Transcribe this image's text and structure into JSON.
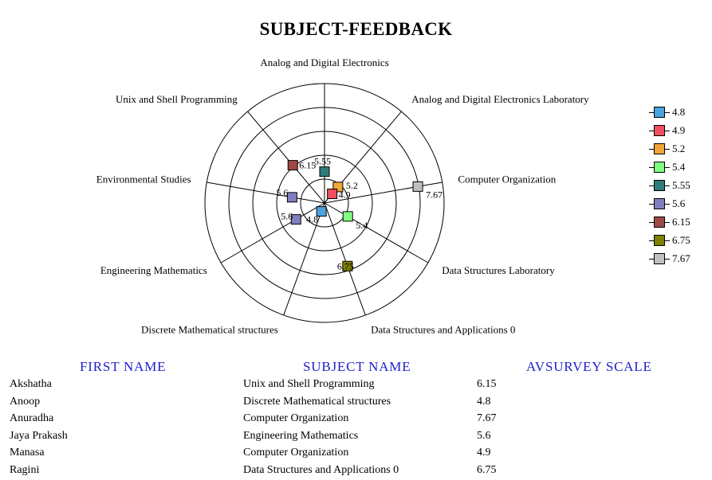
{
  "title": "SUBJECT-FEEDBACK",
  "chart_data": {
    "type": "radar",
    "categories": [
      "Analog and Digital Electronics",
      "Analog and Digital Electronics Laboratory",
      "Computer Organization",
      "Data Structures Laboratory",
      "Data Structures and Applications 0",
      "Discrete Mathematical structures",
      "Engineering Mathematics",
      "Environmental Studies",
      "Unix and Shell Programming"
    ],
    "rlim": [
      4.5,
      8.5
    ],
    "grid": true,
    "legend_position": "right",
    "points": [
      {
        "axis": 0,
        "value": 5.55,
        "label": "5.55",
        "color": "#2e7b7b"
      },
      {
        "axis": 1,
        "value": 5.2,
        "label": "5.2",
        "color": "#f2a536"
      },
      {
        "axis": 1,
        "value": 4.9,
        "label": "4.9",
        "color": "#f05060"
      },
      {
        "axis": 2,
        "value": 7.67,
        "label": "7.67",
        "color": "#c0c0c0"
      },
      {
        "axis": 3,
        "value": 5.4,
        "label": "5.4",
        "color": "#80ff80"
      },
      {
        "axis": 4,
        "value": 6.75,
        "label": "6.75",
        "color": "#808000"
      },
      {
        "axis": 5,
        "value": 4.8,
        "label": "4.8",
        "color": "#4aa3df"
      },
      {
        "axis": 6,
        "value": 5.6,
        "label": "5.6",
        "color": "#7f7fbf"
      },
      {
        "axis": 7,
        "value": 5.6,
        "label": "5.6",
        "color": "#7f7fbf"
      },
      {
        "axis": 8,
        "value": 6.15,
        "label": "6.15",
        "color": "#a04848"
      }
    ],
    "legend": [
      {
        "label": "4.8",
        "color": "#4aa3df"
      },
      {
        "label": "4.9",
        "color": "#f05060"
      },
      {
        "label": "5.2",
        "color": "#f2a536"
      },
      {
        "label": "5.4",
        "color": "#80ff80"
      },
      {
        "label": "5.55",
        "color": "#2e7b7b"
      },
      {
        "label": "5.6",
        "color": "#7f7fbf"
      },
      {
        "label": "6.15",
        "color": "#a04848"
      },
      {
        "label": "6.75",
        "color": "#808000"
      },
      {
        "label": "7.67",
        "color": "#c0c0c0"
      }
    ]
  },
  "table": {
    "headers": [
      "FIRST  NAME",
      "SUBJECT  NAME",
      "AVSURVEY  SCALE"
    ],
    "header_color": "#1c1ccd",
    "rows": [
      [
        "Akshatha",
        "Unix and Shell Programming",
        "6.15"
      ],
      [
        "Anoop",
        "Discrete Mathematical structures",
        "4.8"
      ],
      [
        "Anuradha",
        "Computer Organization",
        "7.67"
      ],
      [
        "Jaya Prakash",
        "Engineering Mathematics",
        "5.6"
      ],
      [
        "Manasa",
        "Computer Organization",
        "4.9"
      ],
      [
        "Ragini",
        "Data Structures and Applications 0",
        "6.75"
      ]
    ]
  }
}
